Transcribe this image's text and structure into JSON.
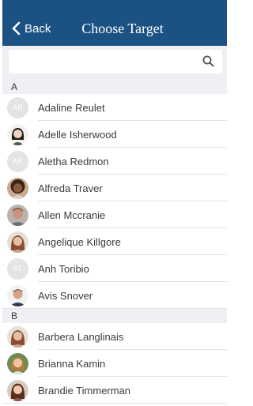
{
  "nav": {
    "back_label": "Back",
    "title": "Choose Target"
  },
  "search": {
    "placeholder": ""
  },
  "sections": [
    {
      "letter": "A",
      "contacts": [
        {
          "name": "Adaline Reulet",
          "initials": "AR"
        },
        {
          "name": "Adelle Isherwood",
          "photo": "photo-5"
        },
        {
          "name": "Aletha Redmon",
          "initials": "AR"
        },
        {
          "name": "Alfreda Traver",
          "photo": "photo-1"
        },
        {
          "name": "Allen Mccranie",
          "photo": "photo-2"
        },
        {
          "name": "Angelique Killgore",
          "photo": "photo-3"
        },
        {
          "name": "Anh Toribio",
          "initials": "AT"
        },
        {
          "name": "Avis Snover",
          "photo": "photo-4"
        }
      ]
    },
    {
      "letter": "B",
      "contacts": [
        {
          "name": "Barbera Langlinais",
          "photo": "photo-3"
        },
        {
          "name": "Brianna Kamin",
          "photo": "photo-6"
        },
        {
          "name": "Brandie Timmerman",
          "photo": "photo-7"
        }
      ]
    }
  ],
  "colors": {
    "nav_bg": "#1b5283",
    "section_bg": "#efeff4",
    "initials_bg": "#e4e4e6"
  }
}
